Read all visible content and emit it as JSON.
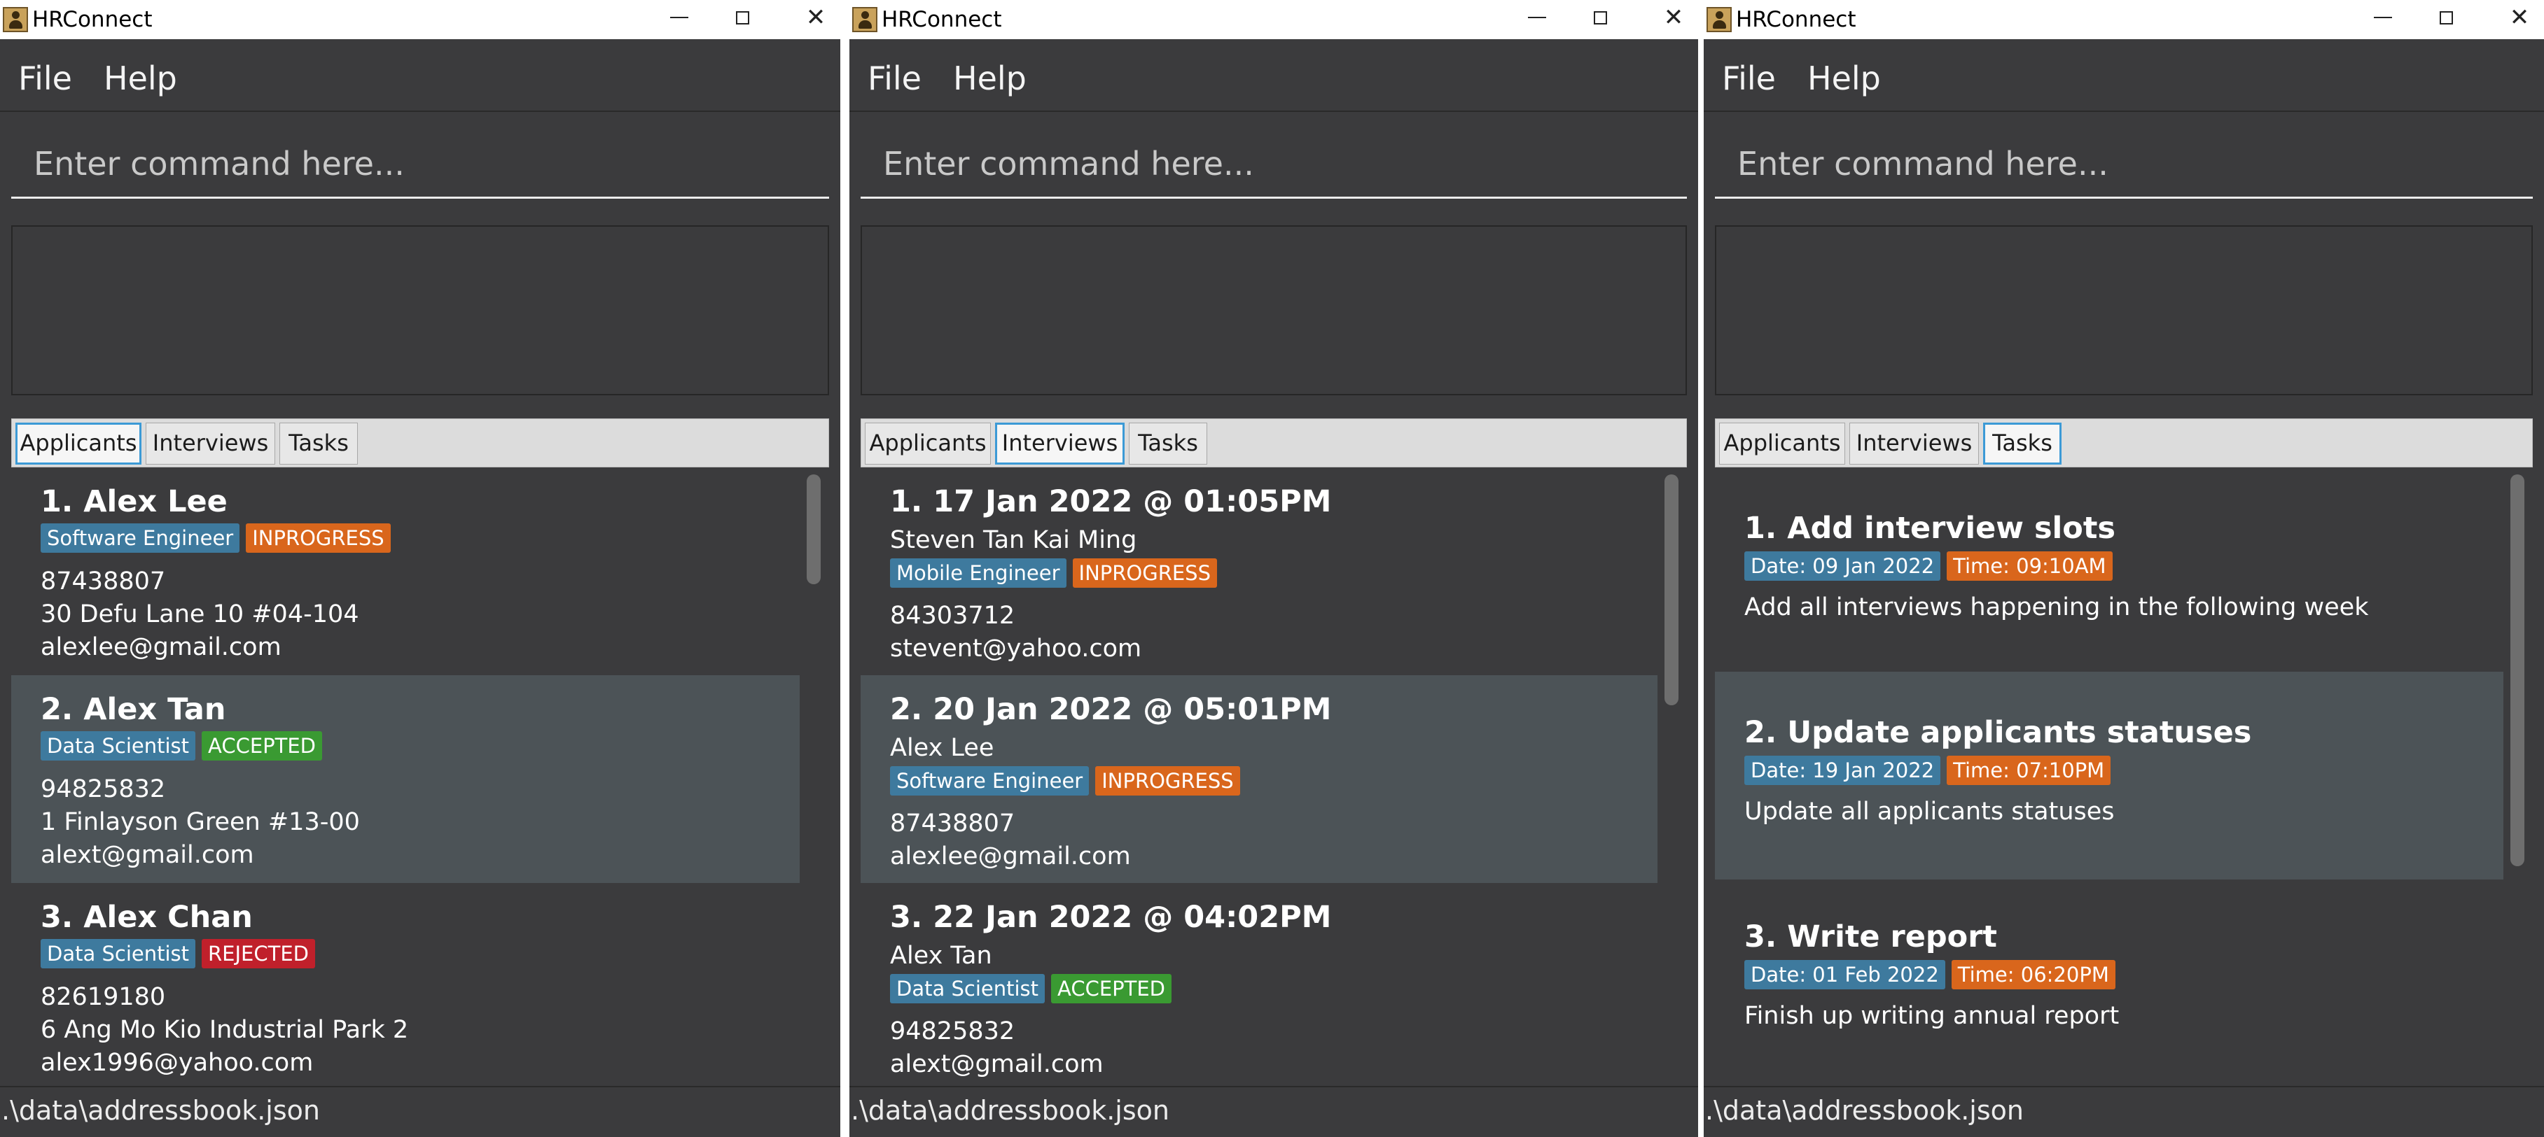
{
  "windows": [
    {
      "title": "HRConnect",
      "menu": {
        "file": "File",
        "help": "Help"
      },
      "command_placeholder": "Enter command here...",
      "tabs": [
        "Applicants",
        "Interviews",
        "Tasks"
      ],
      "active_tab": "Applicants",
      "status_path": ".\\data\\addressbook.json",
      "cards": [
        {
          "header": "1.  Alex Lee",
          "tags": [
            {
              "text": "Software Engineer",
              "color": "#3e7a9e"
            },
            {
              "text": "INPROGRESS",
              "color": "#d9661c"
            }
          ],
          "lines": [
            "87438807",
            "30 Defu Lane 10 #04-104",
            "alexlee@gmail.com"
          ]
        },
        {
          "header": "2.  Alex Tan",
          "tags": [
            {
              "text": "Data Scientist",
              "color": "#3e7a9e"
            },
            {
              "text": "ACCEPTED",
              "color": "#3a9a32"
            }
          ],
          "lines": [
            "94825832",
            "1 Finlayson Green #13-00",
            "alext@gmail.com"
          ]
        },
        {
          "header": "3.  Alex Chan",
          "tags": [
            {
              "text": "Data Scientist",
              "color": "#3e7a9e"
            },
            {
              "text": "REJECTED",
              "color": "#c0202b"
            }
          ],
          "lines": [
            "82619180",
            "6 Ang Mo Kio Industrial Park 2",
            "alex1996@yahoo.com"
          ]
        }
      ]
    },
    {
      "title": "HRConnect",
      "menu": {
        "file": "File",
        "help": "Help"
      },
      "command_placeholder": "Enter command here...",
      "tabs": [
        "Applicants",
        "Interviews",
        "Tasks"
      ],
      "active_tab": "Interviews",
      "status_path": ".\\data\\addressbook.json",
      "cards": [
        {
          "header": "1.  17 Jan 2022 @ 01:05PM",
          "name": "Steven Tan Kai Ming",
          "tags": [
            {
              "text": "Mobile Engineer",
              "color": "#3e7a9e"
            },
            {
              "text": "INPROGRESS",
              "color": "#d9661c"
            }
          ],
          "lines": [
            "84303712",
            "stevent@yahoo.com"
          ]
        },
        {
          "header": "2.  20 Jan 2022 @ 05:01PM",
          "name": "Alex Lee",
          "tags": [
            {
              "text": "Software Engineer",
              "color": "#3e7a9e"
            },
            {
              "text": "INPROGRESS",
              "color": "#d9661c"
            }
          ],
          "lines": [
            "87438807",
            "alexlee@gmail.com"
          ]
        },
        {
          "header": "3.  22 Jan 2022 @ 04:02PM",
          "name": "Alex Tan",
          "tags": [
            {
              "text": "Data Scientist",
              "color": "#3e7a9e"
            },
            {
              "text": "ACCEPTED",
              "color": "#3a9a32"
            }
          ],
          "lines": [
            "94825832",
            "alext@gmail.com"
          ]
        }
      ]
    },
    {
      "title": "HRConnect",
      "menu": {
        "file": "File",
        "help": "Help"
      },
      "command_placeholder": "Enter command here...",
      "tabs": [
        "Applicants",
        "Interviews",
        "Tasks"
      ],
      "active_tab": "Tasks",
      "status_path": ".\\data\\addressbook.json",
      "cards": [
        {
          "header": "1.  Add interview slots",
          "tags": [
            {
              "text": "Date: 09 Jan 2022",
              "color": "#3e7a9e"
            },
            {
              "text": "Time: 09:10AM",
              "color": "#d9661c"
            }
          ],
          "lines": [
            "Add all interviews happening in the following week"
          ]
        },
        {
          "header": "2.  Update applicants statuses",
          "tags": [
            {
              "text": "Date: 19 Jan 2022",
              "color": "#3e7a9e"
            },
            {
              "text": "Time: 07:10PM",
              "color": "#d9661c"
            }
          ],
          "lines": [
            "Update all applicants statuses"
          ]
        },
        {
          "header": "3.  Write report",
          "tags": [
            {
              "text": "Date: 01 Feb 2022",
              "color": "#3e7a9e"
            },
            {
              "text": "Time: 06:20PM",
              "color": "#d9661c"
            }
          ],
          "lines": [
            "Finish up writing annual report"
          ]
        }
      ]
    }
  ]
}
